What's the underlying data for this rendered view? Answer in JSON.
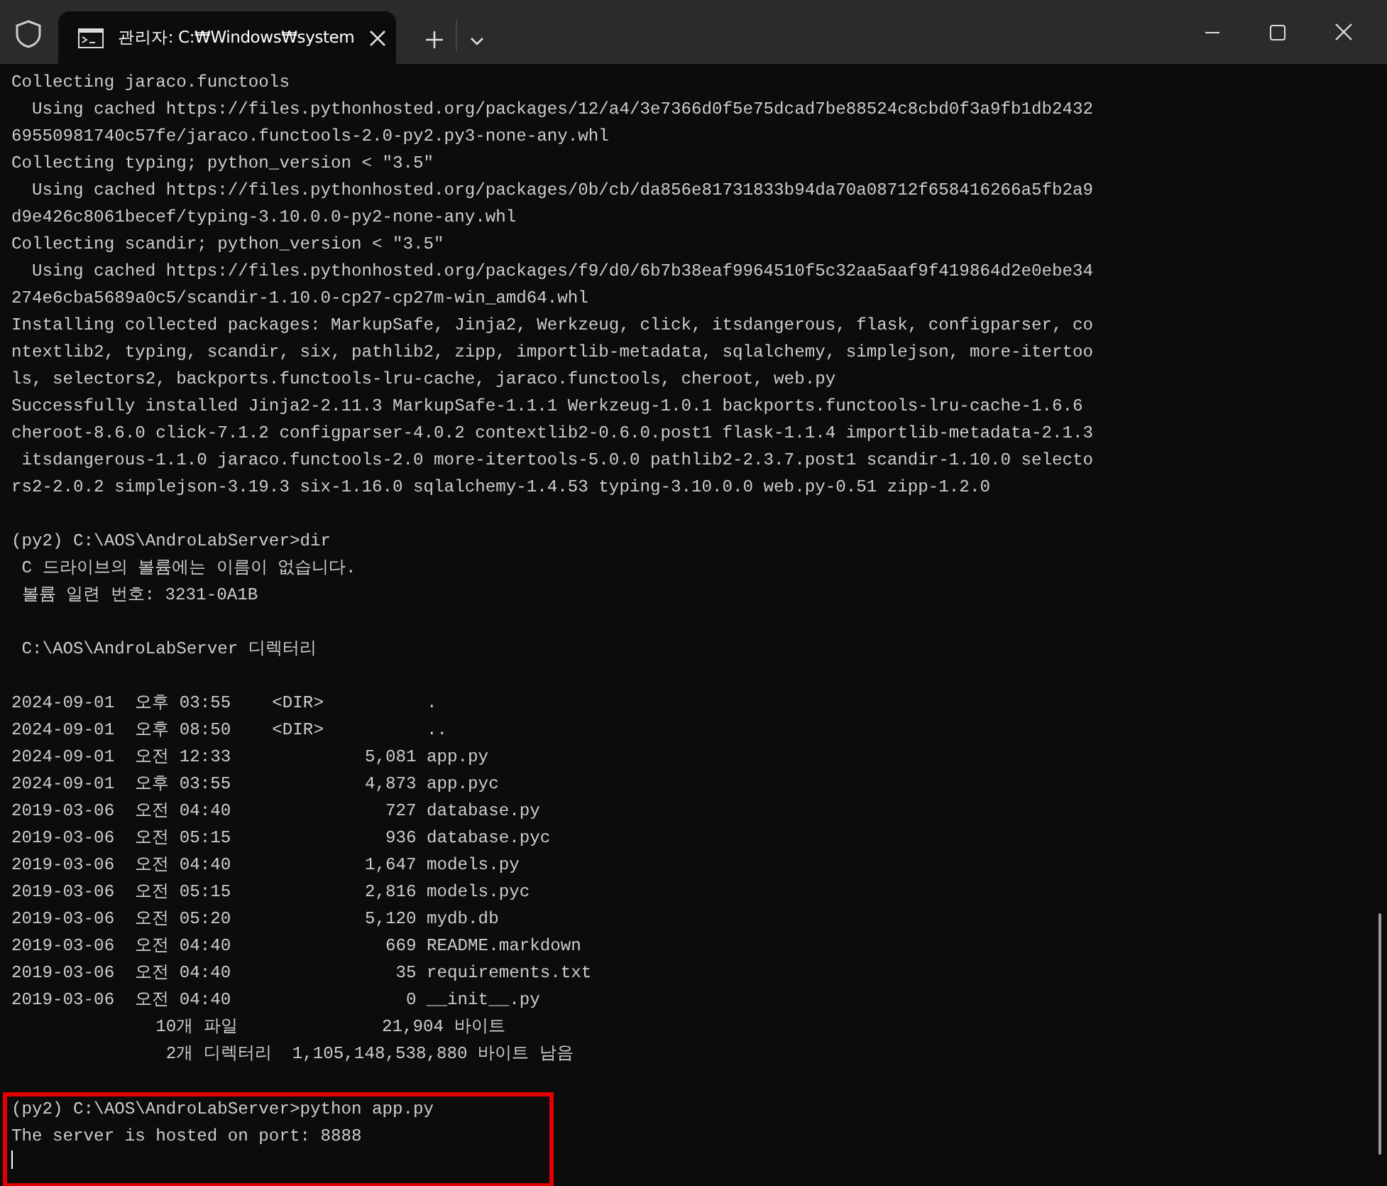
{
  "window": {
    "tabs": [
      {
        "title": "관리자: C:₩Windows₩system",
        "selected": true
      }
    ]
  },
  "terminal": {
    "cursor": true,
    "blocks": [
      {
        "highlighted": false,
        "lines": [
          "Collecting jaraco.functools",
          "  Using cached https://files.pythonhosted.org/packages/12/a4/3e7366d0f5e75dcad7be88524c8cbd0f3a9fb1db2432",
          "69550981740c57fe/jaraco.functools-2.0-py2.py3-none-any.whl",
          "Collecting typing; python_version < \"3.5\"",
          "  Using cached https://files.pythonhosted.org/packages/0b/cb/da856e81731833b94da70a08712f658416266a5fb2a9",
          "d9e426c8061becef/typing-3.10.0.0-py2-none-any.whl",
          "Collecting scandir; python_version < \"3.5\"",
          "  Using cached https://files.pythonhosted.org/packages/f9/d0/6b7b38eaf9964510f5c32aa5aaf9f419864d2e0ebe34",
          "274e6cba5689a0c5/scandir-1.10.0-cp27-cp27m-win_amd64.whl",
          "Installing collected packages: MarkupSafe, Jinja2, Werkzeug, click, itsdangerous, flask, configparser, co",
          "ntextlib2, typing, scandir, six, pathlib2, zipp, importlib-metadata, sqlalchemy, simplejson, more-itertoo",
          "ls, selectors2, backports.functools-lru-cache, jaraco.functools, cheroot, web.py",
          "Successfully installed Jinja2-2.11.3 MarkupSafe-1.1.1 Werkzeug-1.0.1 backports.functools-lru-cache-1.6.6",
          "cheroot-8.6.0 click-7.1.2 configparser-4.0.2 contextlib2-0.6.0.post1 flask-1.1.4 importlib-metadata-2.1.3",
          " itsdangerous-1.1.0 jaraco.functools-2.0 more-itertools-5.0.0 pathlib2-2.3.7.post1 scandir-1.10.0 selecto",
          "rs2-2.0.2 simplejson-3.19.3 six-1.16.0 sqlalchemy-1.4.53 typing-3.10.0.0 web.py-0.51 zipp-1.2.0"
        ]
      },
      {
        "highlighted": false,
        "lines": [
          "(py2) C:\\AOS\\AndroLabServer>dir",
          " C 드라이브의 볼륨에는 이름이 없습니다.",
          " 볼륨 일련 번호: 3231-0A1B"
        ]
      },
      {
        "highlighted": false,
        "lines": [
          " C:\\AOS\\AndroLabServer 디렉터리"
        ]
      },
      {
        "highlighted": false,
        "lines": [
          "2024-09-01  오후 03:55    <DIR>          .",
          "2024-09-01  오후 08:50    <DIR>          ..",
          "2024-09-01  오전 12:33             5,081 app.py",
          "2024-09-01  오후 03:55             4,873 app.pyc",
          "2019-03-06  오전 04:40               727 database.py",
          "2019-03-06  오전 05:15               936 database.pyc",
          "2019-03-06  오전 04:40             1,647 models.py",
          "2019-03-06  오전 05:15             2,816 models.pyc",
          "2019-03-06  오전 05:20             5,120 mydb.db",
          "2019-03-06  오전 04:40               669 README.markdown",
          "2019-03-06  오전 04:40                35 requirements.txt",
          "2019-03-06  오전 04:40                 0 __init__.py",
          "              10개 파일              21,904 바이트",
          "               2개 디렉터리  1,105,148,538,880 바이트 남음"
        ]
      },
      {
        "highlighted": true,
        "lines": [
          "(py2) C:\\AOS\\AndroLabServer>python app.py",
          "The server is hosted on port: 8888"
        ]
      }
    ]
  }
}
